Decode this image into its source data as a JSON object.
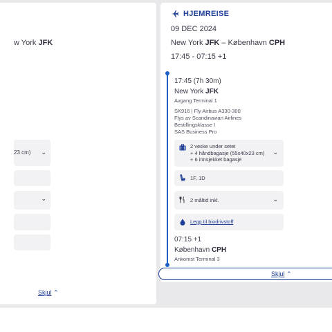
{
  "left_card": {
    "route_prefix": "w York ",
    "route_code": "JFK",
    "baggage_partial": "23 cm)",
    "skjul_label": "Skjul",
    "skjul_chevron": "⌃"
  },
  "right_card": {
    "header_title": "HJEMREISE",
    "date": "09 DEC 2024",
    "route": {
      "from_city": "New York ",
      "from_code": "JFK",
      "separator": " – ",
      "to_city": "København ",
      "to_code": "CPH"
    },
    "times": "17:45 - 07:15 +1",
    "departure": {
      "time": "17:45 (7h 30m)",
      "city": "New York ",
      "code": "JFK",
      "terminal": "Avgang Terminal 1"
    },
    "flight_info": [
      "SK916 | Fly Airbus A330-300",
      "Flys av Scandinavian Airlines",
      "Bestillingsklasse I",
      "SAS Business Pro"
    ],
    "baggage": [
      "2 veske under setet",
      "+ 4 håndbagasje (55x40x23 cm)",
      "+ 6 innsjekket bagasje"
    ],
    "seats": "1F, 1D",
    "meals": "2 måltid inkl.",
    "biofuel_link": "Legg til biodrivstoff",
    "arrival": {
      "time": "07:15 +1",
      "city": "København ",
      "code": "CPH",
      "terminal": "Ankomst Terminal 3"
    },
    "skjul_label": "Skjul",
    "skjul_chevron": "⌃"
  },
  "colors": {
    "brand_blue": "#1f3f98",
    "timeline_blue": "#1f5fc8",
    "background_grey": "#e9e9ec",
    "box_grey": "#f2f2f4"
  },
  "icons": {
    "header": "airplane-icon",
    "baggage": "suitcase-icon",
    "seat": "seat-icon",
    "meal": "cutlery-icon",
    "biofuel": "drop-icon",
    "expand": "chevron-down-icon",
    "collapse": "chevron-up-icon"
  }
}
